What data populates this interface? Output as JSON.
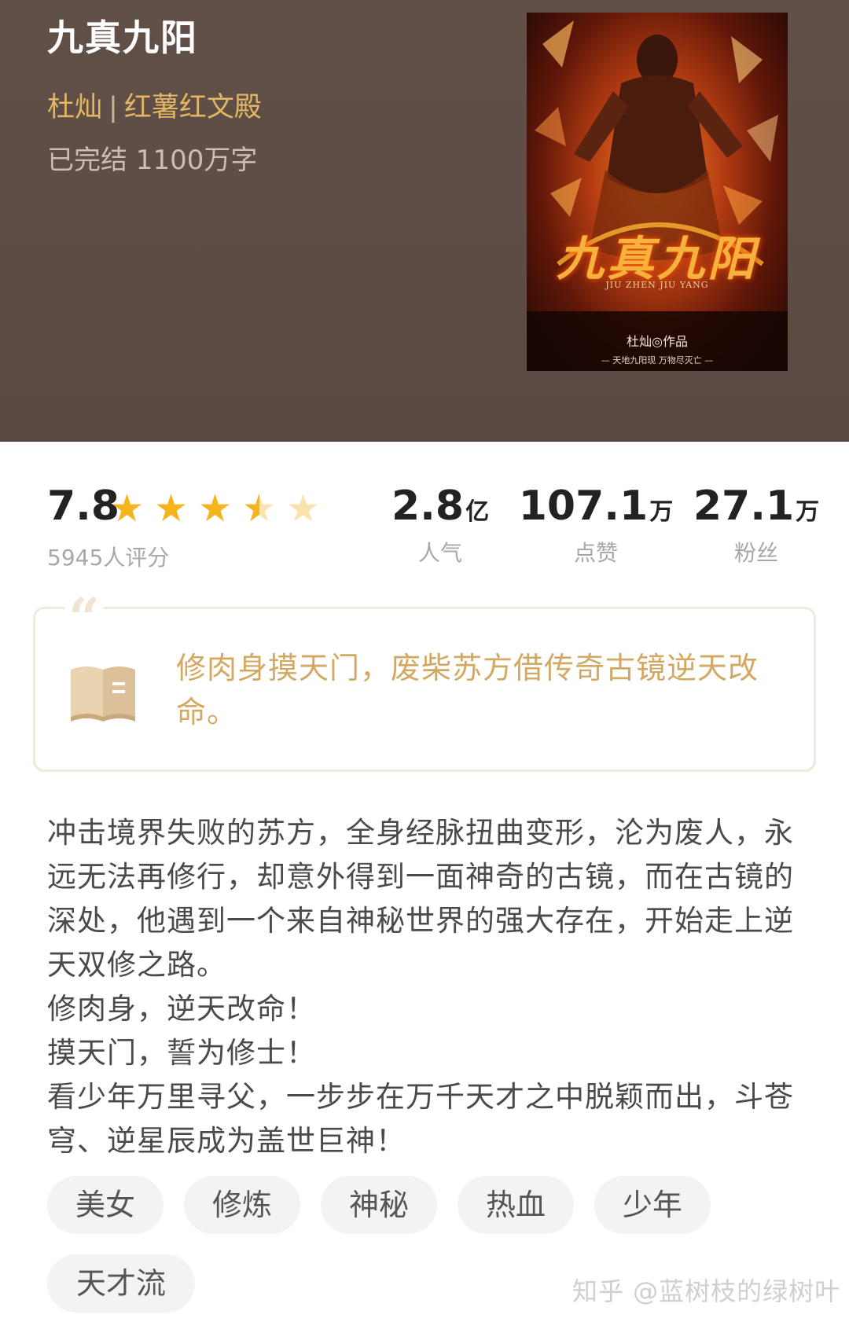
{
  "book": {
    "title": "九真九阳",
    "author": "杜灿",
    "separator": "|",
    "publisher": "红薯红文殿",
    "status": "已完结 1100万字"
  },
  "cover": {
    "title_art": "九真九阳",
    "subtitle": "JIU ZHEN JIU YANG",
    "author_credit": "杜灿◎作品",
    "tagline": "— 天地九阳现  万物尽灭亡 —"
  },
  "rating": {
    "score": "7.8",
    "stars_value": 3.5,
    "stars_max": 5,
    "count_label": "5945人评分"
  },
  "stats": [
    {
      "value": "2.8",
      "unit": "亿",
      "label": "人气"
    },
    {
      "value": "107.1",
      "unit": "万",
      "label": "点赞"
    },
    {
      "value": "27.1",
      "unit": "万",
      "label": "粉丝"
    }
  ],
  "quote": {
    "mark": "“",
    "text": "修肉身摸天门，废柴苏方借传奇古镜逆天改命。"
  },
  "description": {
    "lines": [
      "冲击境界失败的苏方，全身经脉扭曲变形，沦为废人，永远无法再修行，却意外得到一面神奇的古镜，而在古镜的深处，他遇到一个来自神秘世界的强大存在，开始走上逆天双修之路。",
      "修肉身，逆天改命！",
      "摸天门，誓为修士！",
      "看少年万里寻父，一步步在万千天才之中脱颖而出，斗苍穹、逆星辰成为盖世巨神！"
    ]
  },
  "tags": [
    "美女",
    "修炼",
    "神秘",
    "热血",
    "少年",
    "天才流"
  ],
  "watermark": "知乎 @蓝树枝的绿树叶",
  "colors": {
    "header_bg": "#5e4d46",
    "author_gold": "#e3b761",
    "quote_gold": "#d2a862",
    "star_fill": "#f6b51f",
    "star_empty": "#fbe1ad",
    "tag_bg": "#f3f3f3"
  }
}
